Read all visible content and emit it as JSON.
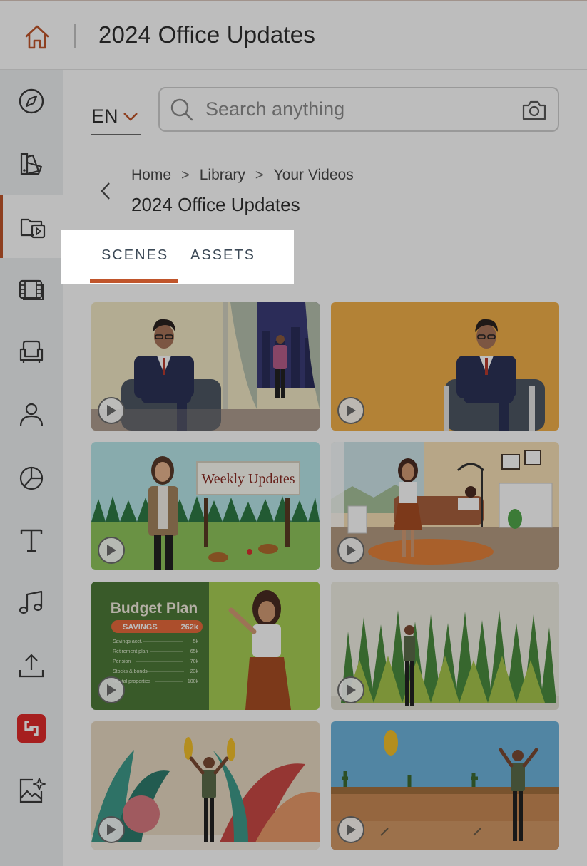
{
  "header": {
    "title": "2024 Office Updates",
    "home_icon": "home-icon"
  },
  "sidebar": {
    "items": [
      {
        "name": "explore",
        "icon": "compass-icon"
      },
      {
        "name": "brand",
        "icon": "palette-icon"
      },
      {
        "name": "library",
        "icon": "video-folder-icon",
        "active": true
      },
      {
        "name": "scenes",
        "icon": "film-icon"
      },
      {
        "name": "props",
        "icon": "armchair-icon"
      },
      {
        "name": "characters",
        "icon": "person-icon"
      },
      {
        "name": "charts",
        "icon": "pie-chart-icon"
      },
      {
        "name": "text",
        "icon": "text-icon"
      },
      {
        "name": "audio",
        "icon": "music-icon"
      },
      {
        "name": "upload",
        "icon": "upload-icon"
      },
      {
        "name": "integration",
        "icon": "app-logo-icon"
      },
      {
        "name": "ai-image",
        "icon": "ai-image-icon"
      }
    ]
  },
  "language": {
    "code": "EN"
  },
  "search": {
    "placeholder": "Search anything"
  },
  "breadcrumb": {
    "home": "Home",
    "library": "Library",
    "videos": "Your Videos"
  },
  "page": {
    "title": "2024 Office Updates"
  },
  "tabs": {
    "scenes": "SCENES",
    "assets": "ASSETS",
    "active": "SCENES"
  },
  "scenes": {
    "weekly_sign": "Weekly Updates",
    "budget_title": "Budget Plan",
    "savings_label": "SAVINGS",
    "savings_value": "262k",
    "rows": [
      {
        "label": "Savings acct.",
        "value": "5k"
      },
      {
        "label": "Retirement plan",
        "value": "65k"
      },
      {
        "label": "Pension",
        "value": "70k"
      },
      {
        "label": "Stocks & bonds",
        "value": "23k"
      },
      {
        "label": "Rental properties",
        "value": "100k"
      }
    ]
  },
  "colors": {
    "accent": "#c0552b",
    "sidebar_bg": "#eef0f2"
  }
}
